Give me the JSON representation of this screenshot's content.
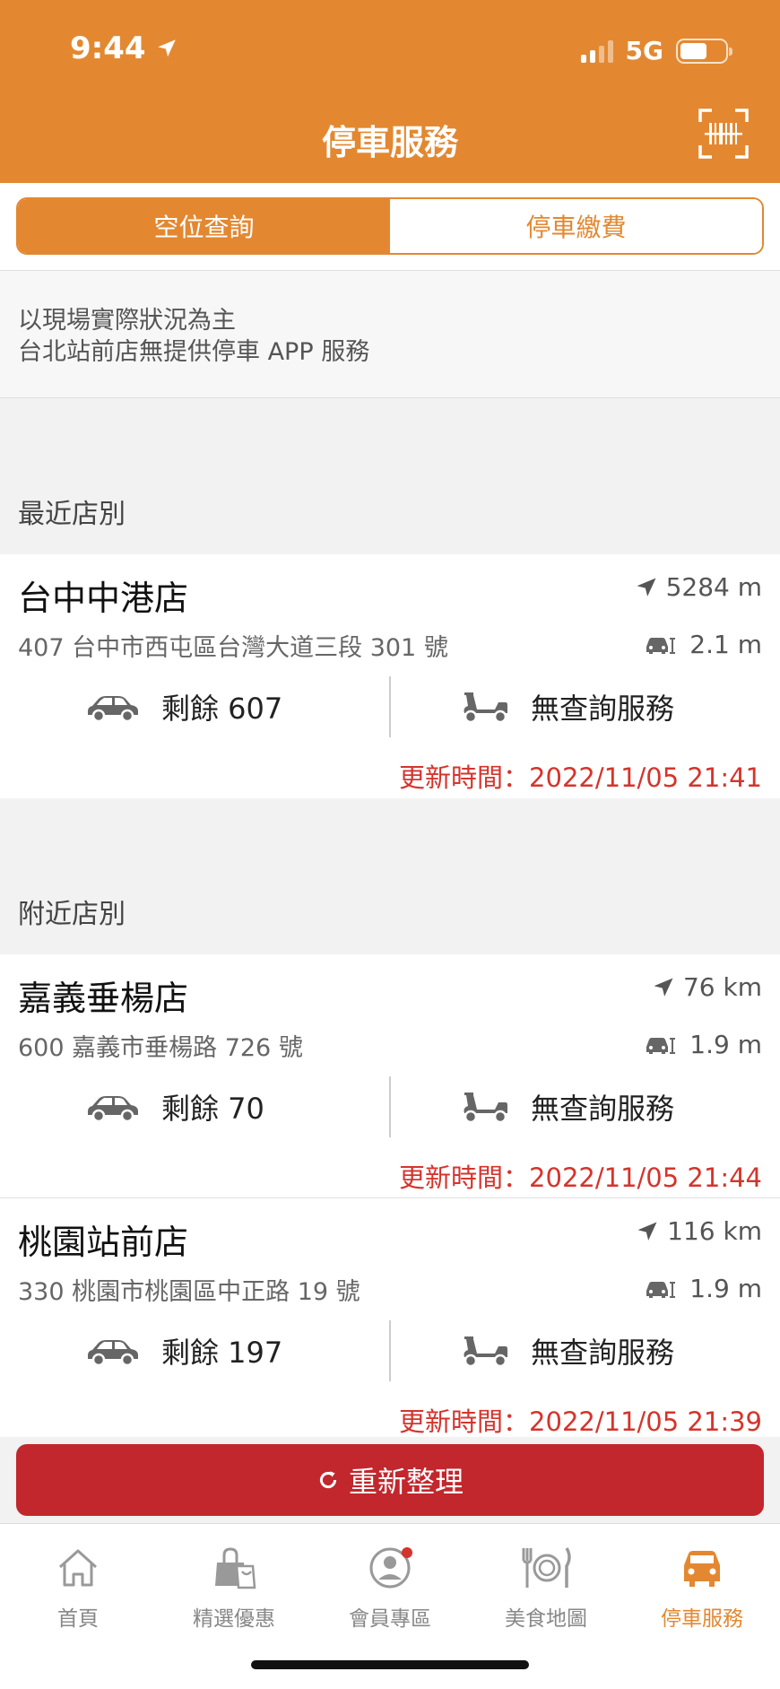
{
  "status": {
    "time": "9:44",
    "network": "5G"
  },
  "header": {
    "title": "停車服務"
  },
  "tabs": [
    {
      "label": "空位查詢",
      "active": true
    },
    {
      "label": "停車繳費",
      "active": false
    }
  ],
  "notice": {
    "line1": "以現場實際狀況為主",
    "line2": "台北站前店無提供停車 APP 服務"
  },
  "sections": {
    "recent": "最近店別",
    "nearby": "附近店別"
  },
  "stores": [
    {
      "name": "台中中港店",
      "distance": "5284 m",
      "address": "407 台中市西屯區台灣大道三段 301 號",
      "drive": "2.1 m",
      "car": "剩餘 607",
      "moto": "無查詢服務",
      "updated": "更新時間：2022/11/05 21:41"
    },
    {
      "name": "嘉義垂楊店",
      "distance": "76 km",
      "address": "600 嘉義市垂楊路 726 號",
      "drive": "1.9 m",
      "car": "剩餘 70",
      "moto": "無查詢服務",
      "updated": "更新時間：2022/11/05 21:44"
    },
    {
      "name": "桃園站前店",
      "distance": "116 km",
      "address": "330 桃園市桃園區中正路 19 號",
      "drive": "1.9 m",
      "car": "剩餘 197",
      "moto": "無查詢服務",
      "updated": "更新時間：2022/11/05 21:39"
    }
  ],
  "refresh": {
    "label": "重新整理"
  },
  "nav": [
    {
      "label": "首頁",
      "icon": "home-icon"
    },
    {
      "label": "精選優惠",
      "icon": "shopping-bag-icon"
    },
    {
      "label": "會員專區",
      "icon": "member-icon"
    },
    {
      "label": "美食地圖",
      "icon": "dining-icon"
    },
    {
      "label": "停車服務",
      "icon": "car-icon",
      "active": true
    }
  ],
  "colors": {
    "brand": "#e38831",
    "alert": "#d5342c",
    "button": "#c1272d"
  }
}
